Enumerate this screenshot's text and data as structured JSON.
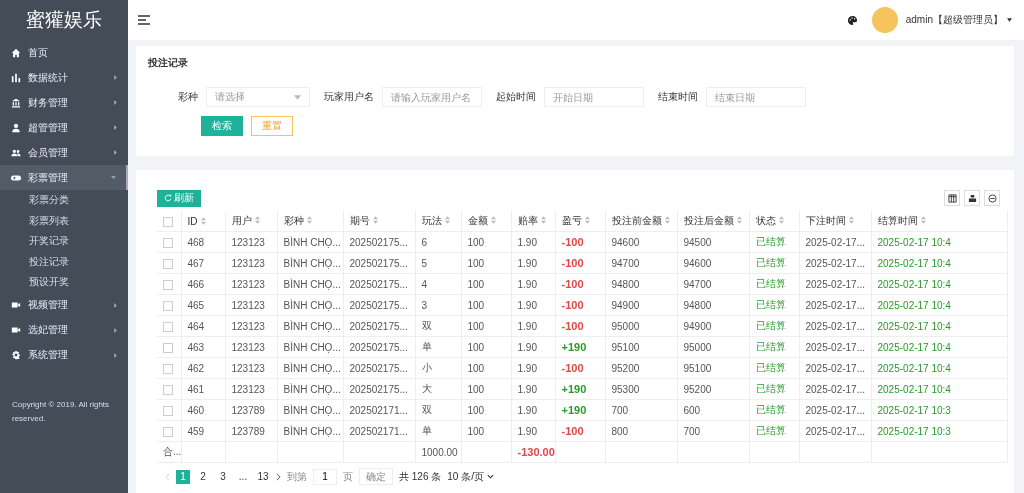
{
  "sidebar": {
    "logo": "蜜獾娱乐",
    "items": [
      {
        "label": "首页",
        "has_arrow": false,
        "expanded": false
      },
      {
        "label": "数据统计",
        "has_arrow": true,
        "expanded": false
      },
      {
        "label": "财务管理",
        "has_arrow": true,
        "expanded": false
      },
      {
        "label": "超管管理",
        "has_arrow": true,
        "expanded": false
      },
      {
        "label": "会员管理",
        "has_arrow": true,
        "expanded": false
      },
      {
        "label": "彩票管理",
        "has_arrow": true,
        "expanded": true,
        "children": [
          {
            "label": "彩票分类"
          },
          {
            "label": "彩票列表"
          },
          {
            "label": "开奖记录"
          },
          {
            "label": "投注记录"
          },
          {
            "label": "预设开奖"
          }
        ]
      },
      {
        "label": "视频管理",
        "has_arrow": true,
        "expanded": false
      },
      {
        "label": "选妃管理",
        "has_arrow": true,
        "expanded": false
      },
      {
        "label": "系统管理",
        "has_arrow": true,
        "expanded": false
      }
    ],
    "copyright": "Copyright © 2019. All rights reserved."
  },
  "topbar": {
    "user": "admin【超级管理员】"
  },
  "search": {
    "title": "投注记录",
    "fields": [
      {
        "label": "彩种",
        "placeholder": "请选择",
        "kind": "select"
      },
      {
        "label": "玩家用户名",
        "placeholder": "请输入玩家用户名",
        "kind": "text"
      },
      {
        "label": "起始时间",
        "placeholder": "开始日期",
        "kind": "text"
      },
      {
        "label": "结束时间",
        "placeholder": "结束日期",
        "kind": "text"
      }
    ],
    "buttons": [
      "检索",
      "重置"
    ]
  },
  "table": {
    "refresh": "刷新",
    "all_checked": false,
    "columns": [
      "ID",
      "用户",
      "彩种",
      "期号",
      "玩法",
      "金额",
      "赔率",
      "盈亏",
      "投注前金额",
      "投注后金额",
      "状态",
      "下注时间",
      "结算时间"
    ],
    "rows": [
      {
        "checked": false,
        "cells": [
          "468",
          "123123",
          "BÌNH CHỌ...",
          "202502175...",
          "6",
          "100",
          "1.90",
          "-100",
          "94600",
          "94500",
          "已结算",
          "2025-02-17...",
          "2025-02-17 10:4"
        ],
        "color": "#e54545"
      },
      {
        "checked": false,
        "cells": [
          "467",
          "123123",
          "BÌNH CHỌ...",
          "202502175...",
          "5",
          "100",
          "1.90",
          "-100",
          "94700",
          "94600",
          "已结算",
          "2025-02-17...",
          "2025-02-17 10:4"
        ],
        "color": "#e54545"
      },
      {
        "checked": false,
        "cells": [
          "466",
          "123123",
          "BÌNH CHỌ...",
          "202502175...",
          "4",
          "100",
          "1.90",
          "-100",
          "94800",
          "94700",
          "已结算",
          "2025-02-17...",
          "2025-02-17 10:4"
        ],
        "color": "#e54545"
      },
      {
        "checked": false,
        "cells": [
          "465",
          "123123",
          "BÌNH CHỌ...",
          "202502175...",
          "3",
          "100",
          "1.90",
          "-100",
          "94900",
          "94800",
          "已结算",
          "2025-02-17...",
          "2025-02-17 10:4"
        ],
        "color": "#e54545"
      },
      {
        "checked": false,
        "cells": [
          "464",
          "123123",
          "BÌNH CHỌ...",
          "202502175...",
          "双",
          "100",
          "1.90",
          "-100",
          "95000",
          "94900",
          "已结算",
          "2025-02-17...",
          "2025-02-17 10:4"
        ],
        "color": "#e54545"
      },
      {
        "checked": false,
        "cells": [
          "463",
          "123123",
          "BÌNH CHỌ...",
          "202502175...",
          "单",
          "100",
          "1.90",
          "+190",
          "95100",
          "95000",
          "已结算",
          "2025-02-17...",
          "2025-02-17 10:4"
        ],
        "color": "#2a9a2a"
      },
      {
        "checked": false,
        "cells": [
          "462",
          "123123",
          "BÌNH CHỌ...",
          "202502175...",
          "小",
          "100",
          "1.90",
          "-100",
          "95200",
          "95100",
          "已结算",
          "2025-02-17...",
          "2025-02-17 10:4"
        ],
        "color": "#e54545"
      },
      {
        "checked": false,
        "cells": [
          "461",
          "123123",
          "BÌNH CHỌ...",
          "202502175...",
          "大",
          "100",
          "1.90",
          "+190",
          "95300",
          "95200",
          "已结算",
          "2025-02-17...",
          "2025-02-17 10:4"
        ],
        "color": "#2a9a2a"
      },
      {
        "checked": false,
        "cells": [
          "460",
          "123789",
          "BÌNH CHỌ...",
          "202502171...",
          "双",
          "100",
          "1.90",
          "+190",
          "700",
          "600",
          "已结算",
          "2025-02-17...",
          "2025-02-17 10:3"
        ],
        "color": "#2a9a2a"
      },
      {
        "checked": false,
        "cells": [
          "459",
          "123789",
          "BÌNH CHỌ...",
          "202502171...",
          "单",
          "100",
          "1.90",
          "-100",
          "800",
          "700",
          "已结算",
          "2025-02-17...",
          "2025-02-17 10:3"
        ],
        "color": "#e54545"
      }
    ],
    "total": {
      "label": "合...",
      "amount": "1000.00",
      "profit": "-130.00",
      "color": "#e54545"
    }
  },
  "pager": {
    "pages": [
      {
        "label": "1",
        "selected": true
      },
      {
        "label": "2",
        "selected": false
      },
      {
        "label": "3",
        "selected": false
      },
      {
        "label": "...",
        "selected": false
      },
      {
        "label": "13",
        "selected": false
      }
    ],
    "goto": "到第",
    "page_value": "1",
    "page_unit": "页",
    "confirm": "确定",
    "count": "共 126 条",
    "size": "10 条/页"
  }
}
